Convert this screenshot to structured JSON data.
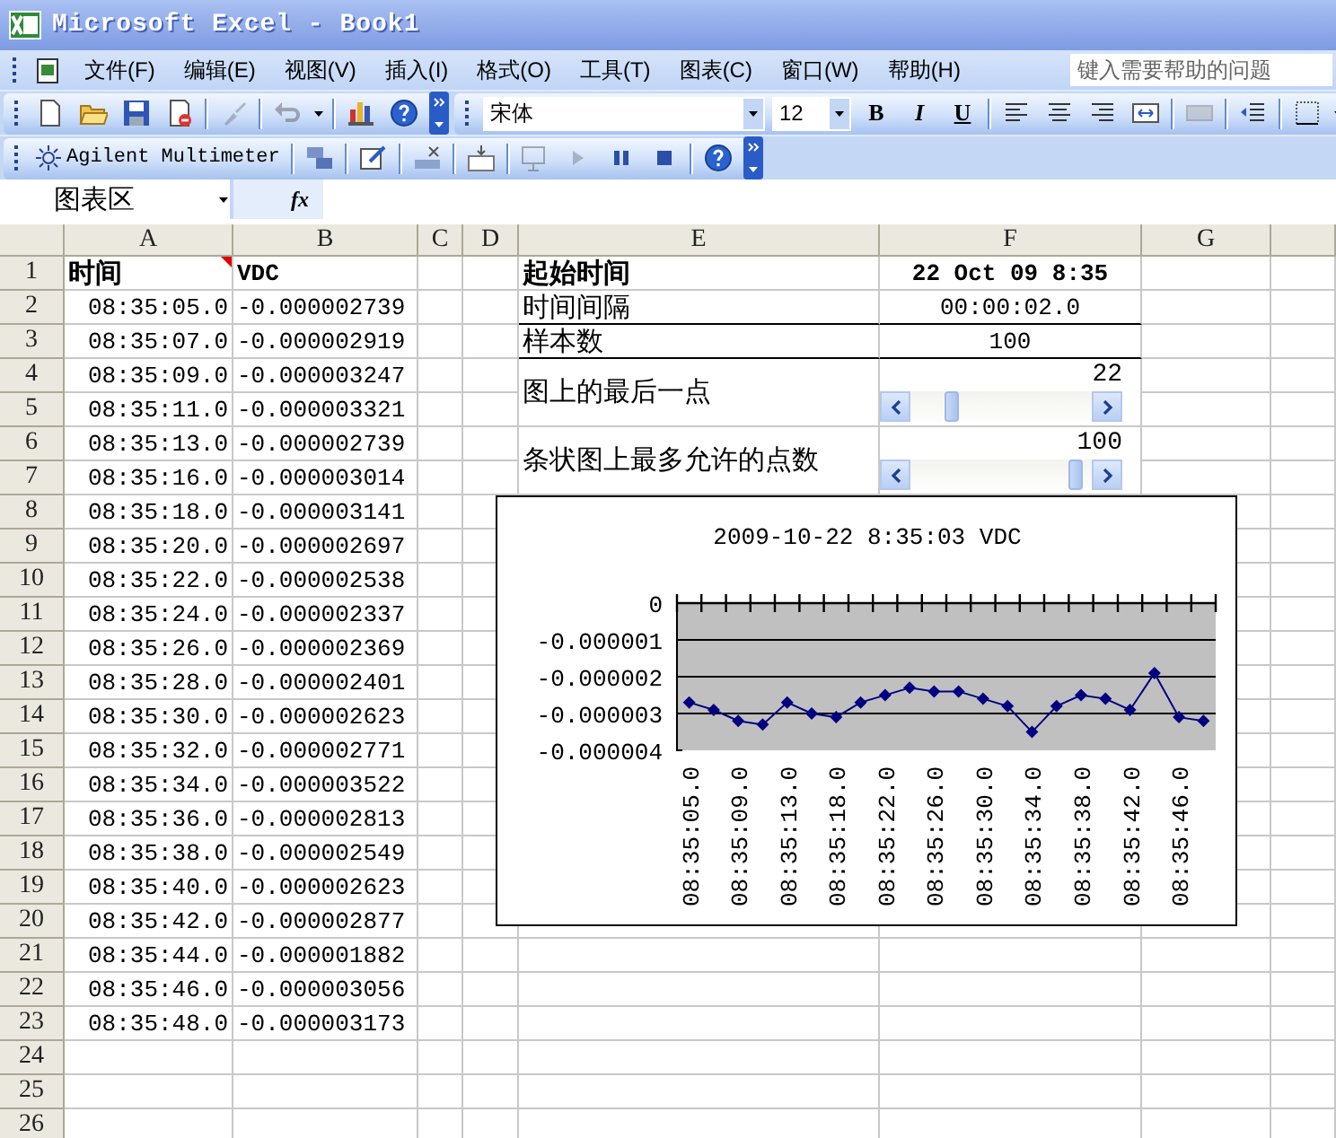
{
  "window": {
    "title": "Microsoft Excel - Book1"
  },
  "menu": [
    "文件(F)",
    "编辑(E)",
    "视图(V)",
    "插入(I)",
    "格式(O)",
    "工具(T)",
    "图表(C)",
    "窗口(W)",
    "帮助(H)"
  ],
  "help_search": {
    "placeholder": "键入需要帮助的问题"
  },
  "formatting": {
    "font": "宋体",
    "size": "12",
    "bold": "B",
    "italic": "I",
    "underline": "U"
  },
  "multimeter_toolbar": {
    "label": "Agilent Multimeter"
  },
  "formula_bar": {
    "name_box": "图表区",
    "fx": "fx"
  },
  "sheet": {
    "columns": [
      "A",
      "B",
      "C",
      "D",
      "E",
      "F",
      "G"
    ],
    "rows": [
      {
        "number": "1",
        "A": {
          "text": "时间",
          "bold": true,
          "comment": true,
          "kind": "header"
        },
        "B": {
          "text": "VDC",
          "bold": true
        },
        "E": {
          "text": "起始时间",
          "bold": true
        },
        "F": {
          "text": "22 Oct 09 8:35",
          "bold": true
        }
      },
      {
        "number": "2",
        "A": {
          "text": "08:35:05.0"
        },
        "B": {
          "text": "-0.000002739"
        },
        "E": {
          "text": "时间间隔",
          "rule_below": true
        },
        "F": {
          "text": "00:00:02.0",
          "rule_below": true
        }
      },
      {
        "number": "3",
        "A": {
          "text": "08:35:07.0"
        },
        "B": {
          "text": "-0.000002919"
        },
        "E": {
          "text": "样本数",
          "rule_below": true
        },
        "F": {
          "text": "100",
          "rule_below": true
        }
      },
      {
        "number": "4",
        "A": {
          "text": "08:35:09.0"
        },
        "B": {
          "text": "-0.000003247"
        },
        "slider": {
          "label": "图上的最后一点",
          "value": "22",
          "level": 0.2
        }
      },
      {
        "number": "5",
        "A": {
          "text": "08:35:11.0"
        },
        "B": {
          "text": "-0.000003321"
        }
      },
      {
        "number": "6",
        "A": {
          "text": "08:35:13.0"
        },
        "B": {
          "text": "-0.000002739"
        },
        "slider": {
          "label": "条状图上最多允许的点数",
          "value": "100",
          "level": 0.95
        }
      },
      {
        "number": "7",
        "A": {
          "text": "08:35:16.0"
        },
        "B": {
          "text": "-0.000003014"
        }
      },
      {
        "number": "8",
        "A": {
          "text": "08:35:18.0"
        },
        "B": {
          "text": "-0.000003141"
        }
      },
      {
        "number": "9",
        "A": {
          "text": "08:35:20.0"
        },
        "B": {
          "text": "-0.000002697"
        }
      },
      {
        "number": "10",
        "A": {
          "text": "08:35:22.0"
        },
        "B": {
          "text": "-0.000002538"
        }
      },
      {
        "number": "11",
        "A": {
          "text": "08:35:24.0"
        },
        "B": {
          "text": "-0.000002337"
        }
      },
      {
        "number": "12",
        "A": {
          "text": "08:35:26.0"
        },
        "B": {
          "text": "-0.000002369"
        }
      },
      {
        "number": "13",
        "A": {
          "text": "08:35:28.0"
        },
        "B": {
          "text": "-0.000002401"
        }
      },
      {
        "number": "14",
        "A": {
          "text": "08:35:30.0"
        },
        "B": {
          "text": "-0.000002623"
        }
      },
      {
        "number": "15",
        "A": {
          "text": "08:35:32.0"
        },
        "B": {
          "text": "-0.000002771"
        }
      },
      {
        "number": "16",
        "A": {
          "text": "08:35:34.0"
        },
        "B": {
          "text": "-0.000003522"
        }
      },
      {
        "number": "17",
        "A": {
          "text": "08:35:36.0"
        },
        "B": {
          "text": "-0.000002813"
        }
      },
      {
        "number": "18",
        "A": {
          "text": "08:35:38.0"
        },
        "B": {
          "text": "-0.000002549"
        }
      },
      {
        "number": "19",
        "A": {
          "text": "08:35:40.0"
        },
        "B": {
          "text": "-0.000002623"
        }
      },
      {
        "number": "20",
        "A": {
          "text": "08:35:42.0"
        },
        "B": {
          "text": "-0.000002877"
        }
      },
      {
        "number": "21",
        "A": {
          "text": "08:35:44.0"
        },
        "B": {
          "text": "-0.000001882"
        }
      },
      {
        "number": "22",
        "A": {
          "text": "08:35:46.0"
        },
        "B": {
          "text": "-0.000003056"
        }
      },
      {
        "number": "23",
        "A": {
          "text": "08:35:48.0"
        },
        "B": {
          "text": "-0.000003173"
        }
      },
      {
        "number": "24"
      },
      {
        "number": "25"
      },
      {
        "number": "26"
      }
    ],
    "chart": {
      "chart_data": {
        "type": "line",
        "title": "2009-10-22 8:35:03 VDC",
        "categories": [
          "08:35:05.0",
          null,
          "08:35:09.0",
          null,
          "08:35:13.0",
          null,
          "08:35:18.0",
          null,
          "08:35:22.0",
          null,
          "08:35:26.0",
          null,
          "08:35:30.0",
          null,
          "08:35:34.0",
          null,
          "08:35:38.0",
          null,
          "08:35:42.0",
          null,
          "08:35:46.0",
          null
        ],
        "grid": true,
        "series": [
          {
            "color": "#000080",
            "marker": "diamond",
            "values": [
              -2.7e-06,
              -2.9e-06,
              -3.2e-06,
              -3.3e-06,
              -2.7e-06,
              -3e-06,
              -3.1e-06,
              -2.7e-06,
              -2.5e-06,
              -2.3e-06,
              -2.4e-06,
              -2.4e-06,
              -2.6e-06,
              -2.8e-06,
              -3.5e-06,
              -2.8e-06,
              -2.5e-06,
              -2.6e-06,
              -2.9e-06,
              -1.9e-06,
              -3.1e-06,
              -3.2e-06
            ]
          }
        ],
        "ylim": [
          -4e-06,
          0
        ],
        "yticks": [
          {
            "value": 0,
            "label": "0"
          },
          {
            "value": -1e-06,
            "label": "-0.000001"
          },
          {
            "value": -2e-06,
            "label": "-0.000002"
          },
          {
            "value": -3e-06,
            "label": "-0.000003"
          },
          {
            "value": -4e-06,
            "label": "-0.000004"
          }
        ]
      }
    }
  }
}
